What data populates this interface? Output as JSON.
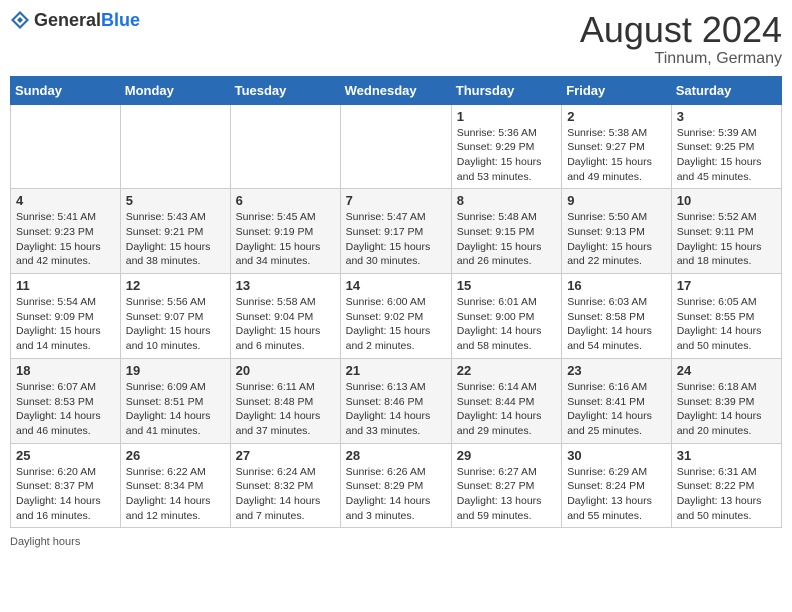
{
  "header": {
    "logo_general": "General",
    "logo_blue": "Blue",
    "month": "August 2024",
    "location": "Tinnum, Germany"
  },
  "weekdays": [
    "Sunday",
    "Monday",
    "Tuesday",
    "Wednesday",
    "Thursday",
    "Friday",
    "Saturday"
  ],
  "weeks": [
    [
      {
        "day": "",
        "info": ""
      },
      {
        "day": "",
        "info": ""
      },
      {
        "day": "",
        "info": ""
      },
      {
        "day": "",
        "info": ""
      },
      {
        "day": "1",
        "info": "Sunrise: 5:36 AM\nSunset: 9:29 PM\nDaylight: 15 hours and 53 minutes."
      },
      {
        "day": "2",
        "info": "Sunrise: 5:38 AM\nSunset: 9:27 PM\nDaylight: 15 hours and 49 minutes."
      },
      {
        "day": "3",
        "info": "Sunrise: 5:39 AM\nSunset: 9:25 PM\nDaylight: 15 hours and 45 minutes."
      }
    ],
    [
      {
        "day": "4",
        "info": "Sunrise: 5:41 AM\nSunset: 9:23 PM\nDaylight: 15 hours and 42 minutes."
      },
      {
        "day": "5",
        "info": "Sunrise: 5:43 AM\nSunset: 9:21 PM\nDaylight: 15 hours and 38 minutes."
      },
      {
        "day": "6",
        "info": "Sunrise: 5:45 AM\nSunset: 9:19 PM\nDaylight: 15 hours and 34 minutes."
      },
      {
        "day": "7",
        "info": "Sunrise: 5:47 AM\nSunset: 9:17 PM\nDaylight: 15 hours and 30 minutes."
      },
      {
        "day": "8",
        "info": "Sunrise: 5:48 AM\nSunset: 9:15 PM\nDaylight: 15 hours and 26 minutes."
      },
      {
        "day": "9",
        "info": "Sunrise: 5:50 AM\nSunset: 9:13 PM\nDaylight: 15 hours and 22 minutes."
      },
      {
        "day": "10",
        "info": "Sunrise: 5:52 AM\nSunset: 9:11 PM\nDaylight: 15 hours and 18 minutes."
      }
    ],
    [
      {
        "day": "11",
        "info": "Sunrise: 5:54 AM\nSunset: 9:09 PM\nDaylight: 15 hours and 14 minutes."
      },
      {
        "day": "12",
        "info": "Sunrise: 5:56 AM\nSunset: 9:07 PM\nDaylight: 15 hours and 10 minutes."
      },
      {
        "day": "13",
        "info": "Sunrise: 5:58 AM\nSunset: 9:04 PM\nDaylight: 15 hours and 6 minutes."
      },
      {
        "day": "14",
        "info": "Sunrise: 6:00 AM\nSunset: 9:02 PM\nDaylight: 15 hours and 2 minutes."
      },
      {
        "day": "15",
        "info": "Sunrise: 6:01 AM\nSunset: 9:00 PM\nDaylight: 14 hours and 58 minutes."
      },
      {
        "day": "16",
        "info": "Sunrise: 6:03 AM\nSunset: 8:58 PM\nDaylight: 14 hours and 54 minutes."
      },
      {
        "day": "17",
        "info": "Sunrise: 6:05 AM\nSunset: 8:55 PM\nDaylight: 14 hours and 50 minutes."
      }
    ],
    [
      {
        "day": "18",
        "info": "Sunrise: 6:07 AM\nSunset: 8:53 PM\nDaylight: 14 hours and 46 minutes."
      },
      {
        "day": "19",
        "info": "Sunrise: 6:09 AM\nSunset: 8:51 PM\nDaylight: 14 hours and 41 minutes."
      },
      {
        "day": "20",
        "info": "Sunrise: 6:11 AM\nSunset: 8:48 PM\nDaylight: 14 hours and 37 minutes."
      },
      {
        "day": "21",
        "info": "Sunrise: 6:13 AM\nSunset: 8:46 PM\nDaylight: 14 hours and 33 minutes."
      },
      {
        "day": "22",
        "info": "Sunrise: 6:14 AM\nSunset: 8:44 PM\nDaylight: 14 hours and 29 minutes."
      },
      {
        "day": "23",
        "info": "Sunrise: 6:16 AM\nSunset: 8:41 PM\nDaylight: 14 hours and 25 minutes."
      },
      {
        "day": "24",
        "info": "Sunrise: 6:18 AM\nSunset: 8:39 PM\nDaylight: 14 hours and 20 minutes."
      }
    ],
    [
      {
        "day": "25",
        "info": "Sunrise: 6:20 AM\nSunset: 8:37 PM\nDaylight: 14 hours and 16 minutes."
      },
      {
        "day": "26",
        "info": "Sunrise: 6:22 AM\nSunset: 8:34 PM\nDaylight: 14 hours and 12 minutes."
      },
      {
        "day": "27",
        "info": "Sunrise: 6:24 AM\nSunset: 8:32 PM\nDaylight: 14 hours and 7 minutes."
      },
      {
        "day": "28",
        "info": "Sunrise: 6:26 AM\nSunset: 8:29 PM\nDaylight: 14 hours and 3 minutes."
      },
      {
        "day": "29",
        "info": "Sunrise: 6:27 AM\nSunset: 8:27 PM\nDaylight: 13 hours and 59 minutes."
      },
      {
        "day": "30",
        "info": "Sunrise: 6:29 AM\nSunset: 8:24 PM\nDaylight: 13 hours and 55 minutes."
      },
      {
        "day": "31",
        "info": "Sunrise: 6:31 AM\nSunset: 8:22 PM\nDaylight: 13 hours and 50 minutes."
      }
    ]
  ],
  "footer": {
    "daylight_label": "Daylight hours"
  }
}
